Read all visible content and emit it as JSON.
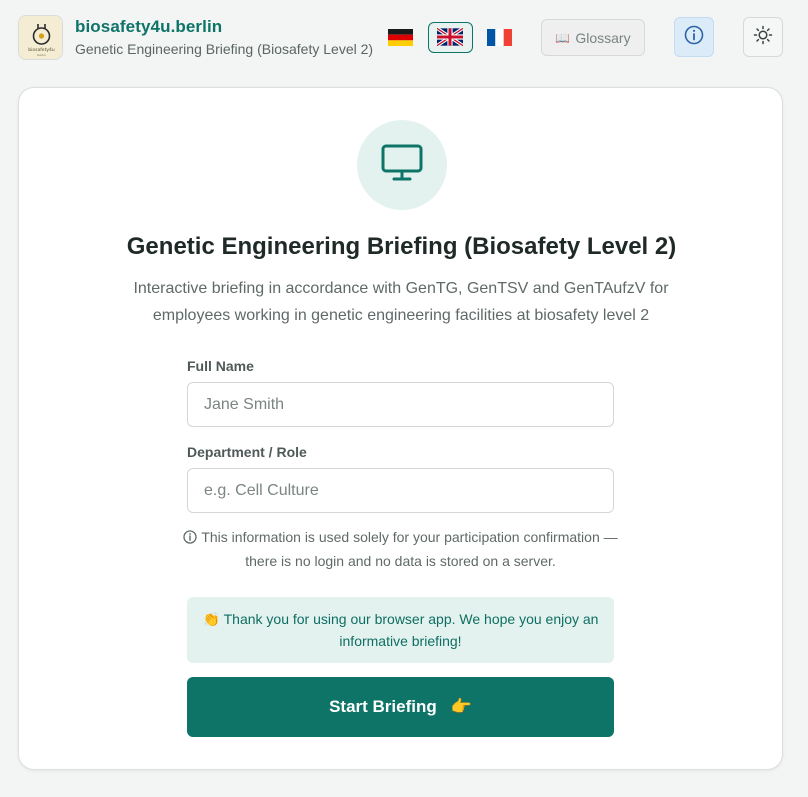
{
  "header": {
    "brand_title": "biosafety4u.berlin",
    "brand_subtitle": "Genetic Engineering Briefing (Biosafety Level 2)",
    "languages": [
      "de-flag",
      "uk-flag",
      "fr-flag"
    ],
    "selected_language": "uk-flag",
    "glossary_label": "Glossary",
    "glossary_icon": "book-icon",
    "info_icon": "info-icon",
    "theme_icon": "sun-icon"
  },
  "main": {
    "hero_icon": "monitor-icon",
    "title": "Genetic Engineering Briefing (Biosafety Level 2)",
    "description": "Interactive briefing in accordance with GenTG, GenTSV and GenTAufzV for employees working in genetic engineering facilities at biosafety level 2",
    "full_name_label": "Full Name",
    "full_name_placeholder": "Jane Smith",
    "department_label": "Department / Role",
    "department_placeholder": "e.g. Cell Culture",
    "privacy_note": "This information is used solely for your participation confirmation — there is no login and no data is stored on a server.",
    "thanks_message": "Thank you for using our browser app. We hope you enjoy an informative briefing!",
    "thanks_emoji": "👏",
    "start_button": "Start Briefing",
    "start_emoji": "👉"
  },
  "colors": {
    "accent": "#0e7468",
    "accent_light": "#e4f2ef",
    "info_button_bg": "#dcebf8"
  }
}
